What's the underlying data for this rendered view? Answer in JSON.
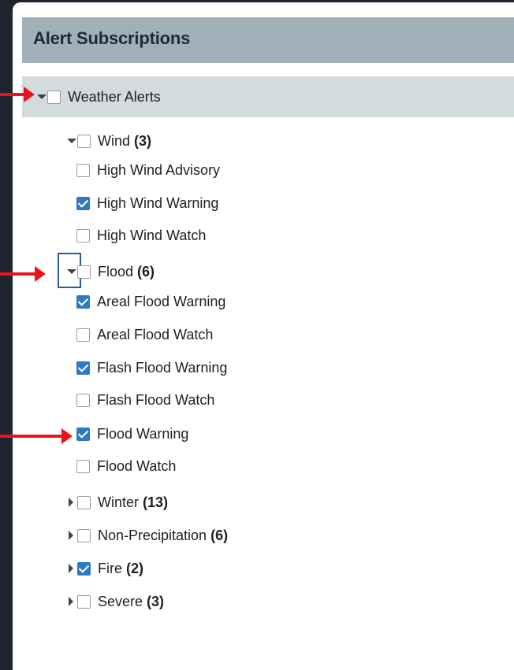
{
  "header": {
    "title": "Alert Subscriptions"
  },
  "root": {
    "label": "Weather Alerts",
    "checked": false,
    "expanded": true
  },
  "wind": {
    "label": "Wind",
    "count": "(3)",
    "checked": false,
    "expanded": true,
    "items": [
      {
        "label": "High Wind Advisory",
        "checked": false
      },
      {
        "label": "High Wind Warning",
        "checked": true
      },
      {
        "label": "High Wind Watch",
        "checked": false
      }
    ]
  },
  "flood": {
    "label": "Flood",
    "count": "(6)",
    "checked": false,
    "expanded": true,
    "items": [
      {
        "label": "Areal Flood Warning",
        "checked": true
      },
      {
        "label": "Areal Flood Watch",
        "checked": false
      },
      {
        "label": "Flash Flood Warning",
        "checked": true
      },
      {
        "label": "Flash Flood Watch",
        "checked": false
      },
      {
        "label": "Flood Warning",
        "checked": true
      },
      {
        "label": "Flood Watch",
        "checked": false
      }
    ]
  },
  "collapsed_groups": [
    {
      "label": "Winter",
      "count": "(13)",
      "checked": false,
      "expanded": false
    },
    {
      "label": "Non-Precipitation",
      "count": "(6)",
      "checked": false,
      "expanded": false
    },
    {
      "label": "Fire",
      "count": "(2)",
      "checked": true,
      "expanded": false
    },
    {
      "label": "Severe",
      "count": "(3)",
      "checked": false,
      "expanded": false
    }
  ],
  "colors": {
    "header_bg": "#9fb0b8",
    "group_bar_bg": "#d3dbdf",
    "checkbox_checked": "#2d79c4",
    "annotation_arrow": "#e8141c",
    "focus_ring": "#2d5c93"
  }
}
